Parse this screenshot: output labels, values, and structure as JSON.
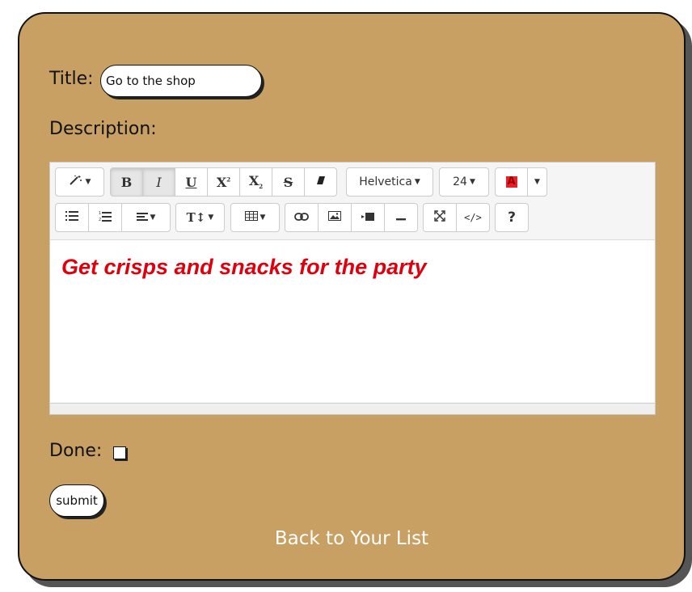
{
  "form": {
    "title_label": "Title:",
    "title_value": "Go to the shop",
    "description_label": "Description:",
    "done_label": "Done:",
    "submit_label": "submit",
    "back_link": "Back to Your List"
  },
  "editor": {
    "font_name": "Helvetica",
    "font_size": "24",
    "content": "Get crisps and snacks for the party",
    "content_color": "#e0000d",
    "toolbar_icons": {
      "bold": "B",
      "italic": "I",
      "underline": "U",
      "superscript": "X",
      "subscript": "X",
      "strikethrough": "S",
      "help": "?"
    }
  },
  "colors": {
    "card_background": "#c8a063",
    "back_link": "#ffffff"
  }
}
